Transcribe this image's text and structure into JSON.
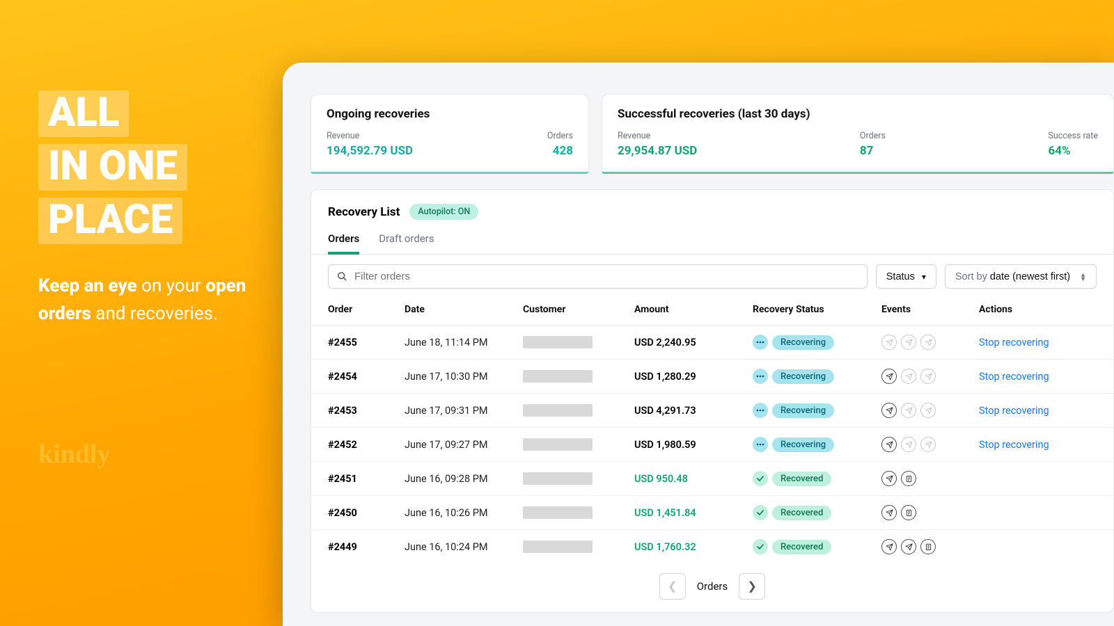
{
  "promo": {
    "line1": "ALL",
    "line2": "IN ONE",
    "line3": "PLACE",
    "sub_bold1": "Keep an eye",
    "sub_plain1": " on your ",
    "sub_bold2": "open orders",
    "sub_plain2": " and recoveries.",
    "logo": "kindly"
  },
  "cards": {
    "ongoing": {
      "title": "Ongoing recoveries",
      "revenue_label": "Revenue",
      "revenue_value": "194,592.79 USD",
      "orders_label": "Orders",
      "orders_value": "428"
    },
    "successful": {
      "title": "Successful recoveries (last 30 days)",
      "revenue_label": "Revenue",
      "revenue_value": "29,954.87 USD",
      "orders_label": "Orders",
      "orders_value": "87",
      "rate_label": "Success rate",
      "rate_value": "64%"
    }
  },
  "panel": {
    "title": "Recovery List",
    "autopilot": "Autopilot: ON",
    "tabs": {
      "orders": "Orders",
      "drafts": "Draft orders"
    },
    "filter_placeholder": "Filter orders",
    "status_button": "Status",
    "sort_prefix": "Sort by ",
    "sort_value": "date (newest first)"
  },
  "columns": {
    "order": "Order",
    "date": "Date",
    "customer": "Customer",
    "amount": "Amount",
    "status": "Recovery Status",
    "events": "Events",
    "actions": "Actions"
  },
  "status_labels": {
    "recovering": "Recovering",
    "recovered": "Recovered"
  },
  "action_labels": {
    "stop": "Stop recovering"
  },
  "rows": [
    {
      "order": "#2455",
      "date": "June 18, 11:14 PM",
      "amount": "USD 2,240.95",
      "amount_class": "",
      "status": "recovering",
      "events": [
        "send-dim",
        "send-dim",
        "send-dim"
      ],
      "action": "stop"
    },
    {
      "order": "#2454",
      "date": "June 17, 10:30 PM",
      "amount": "USD 1,280.29",
      "amount_class": "",
      "status": "recovering",
      "events": [
        "send",
        "send-dim",
        "send-dim"
      ],
      "action": "stop"
    },
    {
      "order": "#2453",
      "date": "June 17, 09:31 PM",
      "amount": "USD 4,291.73",
      "amount_class": "",
      "status": "recovering",
      "events": [
        "send",
        "send-dim",
        "send-dim"
      ],
      "action": "stop"
    },
    {
      "order": "#2452",
      "date": "June 17, 09:27 PM",
      "amount": "USD 1,980.59",
      "amount_class": "",
      "status": "recovering",
      "events": [
        "send",
        "send-dim",
        "send-dim"
      ],
      "action": "stop"
    },
    {
      "order": "#2451",
      "date": "June 16, 09:28 PM",
      "amount": "USD 950.48",
      "amount_class": "green",
      "status": "recovered",
      "events": [
        "send",
        "doc"
      ],
      "action": ""
    },
    {
      "order": "#2450",
      "date": "June 16, 10:26 PM",
      "amount": "USD 1,451.84",
      "amount_class": "green",
      "status": "recovered",
      "events": [
        "send",
        "doc"
      ],
      "action": ""
    },
    {
      "order": "#2449",
      "date": "June 16, 10:24 PM",
      "amount": "USD 1,760.32",
      "amount_class": "green",
      "status": "recovered",
      "events": [
        "send",
        "send",
        "doc"
      ],
      "action": ""
    }
  ],
  "pager": {
    "label": "Orders"
  }
}
